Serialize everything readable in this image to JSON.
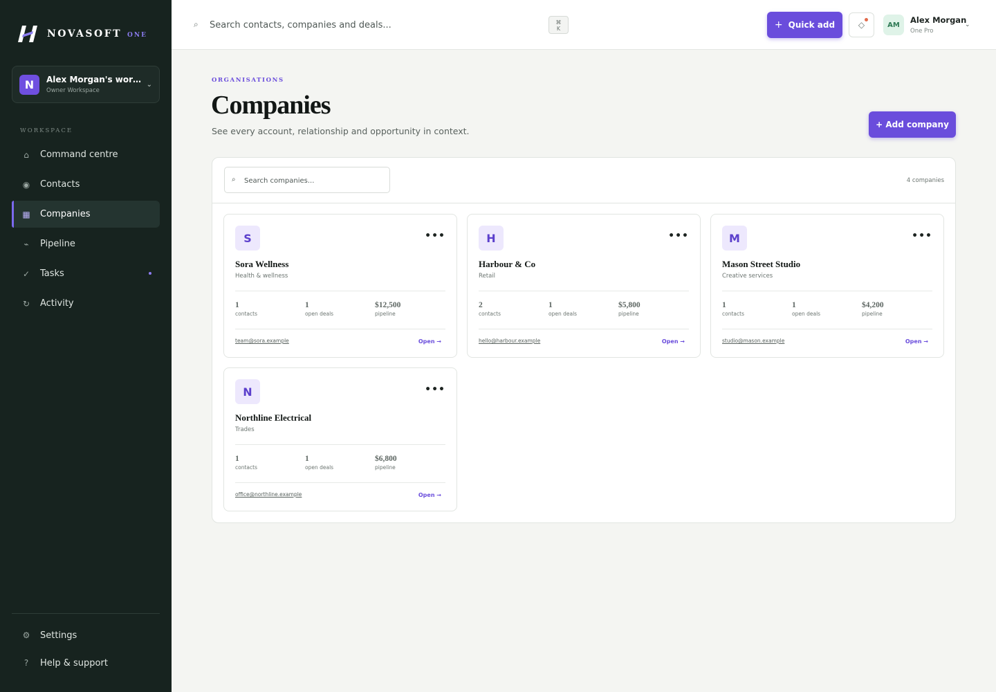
{
  "brand": {
    "name": "NOVASOFT",
    "sub": "ONE"
  },
  "workspace": {
    "initial": "N",
    "name": "Alex Morgan's workspace",
    "role": "Owner Workspace"
  },
  "sidebar": {
    "section": "WORKSPACE",
    "items": [
      {
        "label": "Command centre",
        "icon": "home-icon",
        "glyph": "⌂"
      },
      {
        "label": "Contacts",
        "icon": "contacts-icon",
        "glyph": "◉"
      },
      {
        "label": "Companies",
        "icon": "companies-grid-icon",
        "glyph": "▦",
        "active": true
      },
      {
        "label": "Pipeline",
        "icon": "pipeline-icon",
        "glyph": "⌁"
      },
      {
        "label": "Tasks",
        "icon": "check-icon",
        "glyph": "✓",
        "dot": true
      },
      {
        "label": "Activity",
        "icon": "activity-icon",
        "glyph": "↻"
      }
    ],
    "bottom": [
      {
        "label": "Settings",
        "icon": "gear-icon",
        "glyph": "⚙"
      },
      {
        "label": "Help & support",
        "icon": "help-icon",
        "glyph": "?"
      }
    ]
  },
  "topbar": {
    "search_placeholder": "Search contacts, companies and deals...",
    "shortcut_top": "⌘",
    "shortcut_bottom": "K",
    "quick_add": "Quick add",
    "user": {
      "initials": "AM",
      "name": "Alex Morgan",
      "plan": "One Pro"
    }
  },
  "page": {
    "eyebrow": "ORGANISATIONS",
    "title": "Companies",
    "subtitle": "See every account, relationship and opportunity in context.",
    "add_button": "+ Add company",
    "search_placeholder": "Search companies...",
    "count": "4 companies"
  },
  "companies": [
    {
      "initial": "S",
      "name": "Sora Wellness",
      "industry": "Health & wellness",
      "contacts": "1",
      "deals": "1",
      "pipeline": "$12,500",
      "email": "team@sora.example"
    },
    {
      "initial": "H",
      "name": "Harbour & Co",
      "industry": "Retail",
      "contacts": "2",
      "deals": "1",
      "pipeline": "$5,800",
      "email": "hello@harbour.example"
    },
    {
      "initial": "M",
      "name": "Mason Street Studio",
      "industry": "Creative services",
      "contacts": "1",
      "deals": "1",
      "pipeline": "$4,200",
      "email": "studio@mason.example"
    },
    {
      "initial": "N",
      "name": "Northline Electrical",
      "industry": "Trades",
      "contacts": "1",
      "deals": "1",
      "pipeline": "$6,800",
      "email": "office@northline.example"
    }
  ],
  "card_labels": {
    "contacts": "contacts",
    "deals": "open deals",
    "pipeline": "pipeline",
    "more": "•••",
    "open": "Open →"
  },
  "colors": {
    "sidebar_bg": "#17231f",
    "accent": "#6a4ddc",
    "page_bg": "#f4f5f2",
    "logo_tile": "#ede8fd"
  }
}
